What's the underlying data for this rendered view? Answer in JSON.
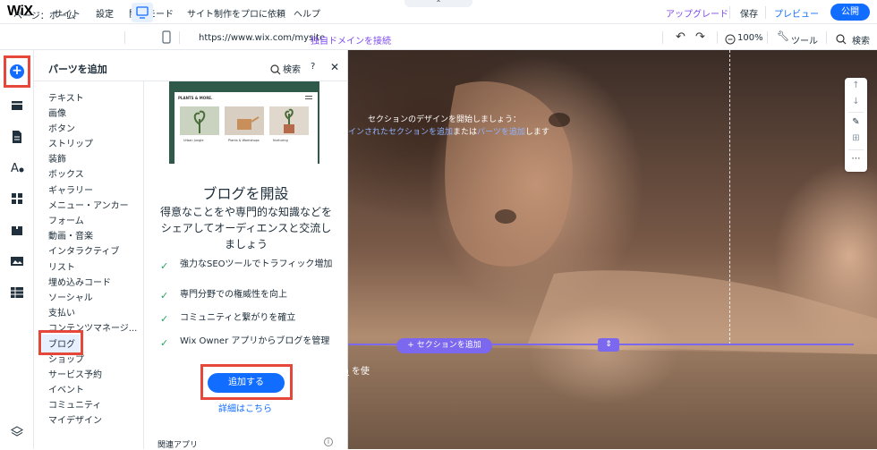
{
  "topbar": {
    "logo": "WiX",
    "menu": [
      "サイト",
      "設定",
      "開発モード",
      "サイト制作をプロに依頼",
      "ヘルプ"
    ],
    "upgrade": "アップグレード",
    "save": "保存",
    "preview": "プレビュー",
    "publish": "公開"
  },
  "secondbar": {
    "page": "ページ：ホーム",
    "url": "https://www.wix.com/mysite",
    "domain_link": "独自ドメインを接続",
    "zoom": "100%",
    "tools": "ツール",
    "search": "検索"
  },
  "panel": {
    "title": "パーツを追加",
    "search": "検索",
    "help": "?",
    "close": "✕",
    "categories": [
      "テキスト",
      "画像",
      "ボタン",
      "ストリップ",
      "装飾",
      "ボックス",
      "ギャラリー",
      "メニュー・アンカー",
      "フォーム",
      "動画・音楽",
      "インタラクティブ",
      "リスト",
      "埋め込みコード",
      "ソーシャル",
      "支払い",
      "コンテンツマネージ...",
      "ブログ",
      "ショップ",
      "サービス予約",
      "イベント",
      "コミュニティ",
      "マイデザイン"
    ],
    "selected_category": "ブログ",
    "preview_brand": "PLANTS & MORE.",
    "preview_cards": [
      "Urban Jungle",
      "Plants & Workshops",
      "Nurturing"
    ],
    "detail_title": "ブログを開設",
    "detail_desc": "得意なことをや専門的な知識などをシェアしてオーディエンスと交流しましょう",
    "features": [
      "強力なSEOツールでトラフィック増加",
      "専門分野での権威性を向上",
      "コミュニティと繋がりを確立",
      "Wix Owner アプリからブログを管理"
    ],
    "add_button": "追加する",
    "more_link": "詳細はこちら",
    "related": "関連アプリ"
  },
  "canvas": {
    "line1": "セクションのデザインを開始しましょう：",
    "line2_a": "インされたセクション",
    "line2_b": "を追加",
    "line2_c": "または",
    "line2_d": "パーツを追加",
    "line2_e": "します",
    "add_section": "+ セクションを追加",
    "footer_text_a": "m",
    "footer_text_b": " を使"
  },
  "colors": {
    "accent": "#116dff",
    "upgrade": "#7d4bf0",
    "highlight": "#e5473b",
    "section": "#7b68ee",
    "check": "#25a55f"
  }
}
